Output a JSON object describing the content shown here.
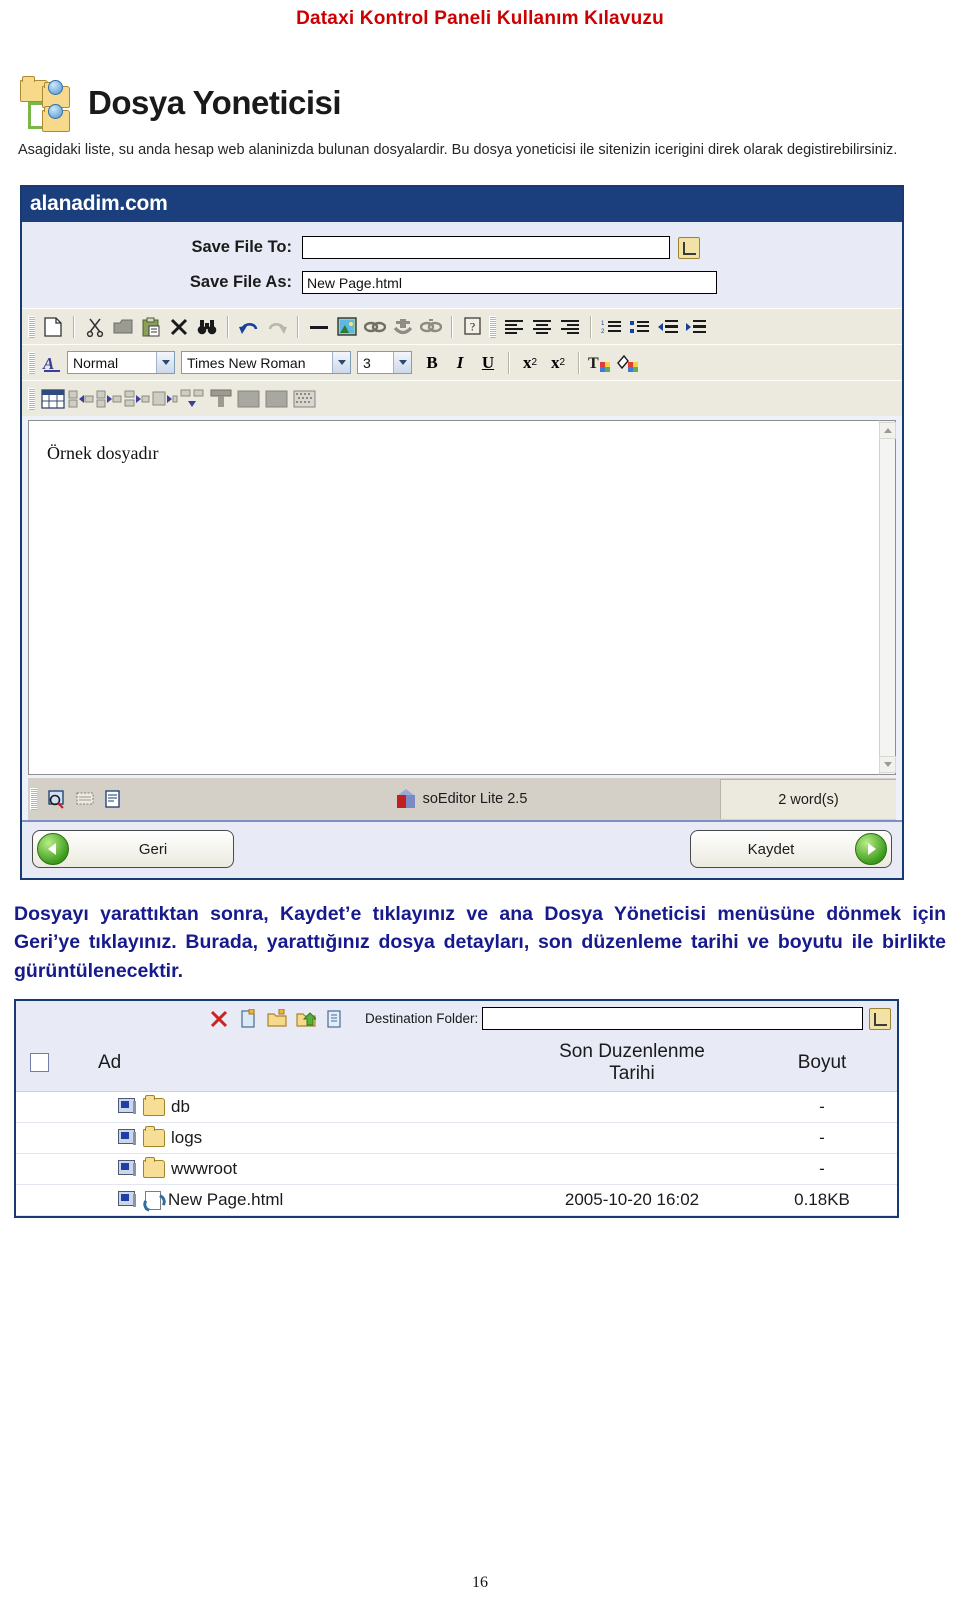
{
  "document": {
    "header_title": "Dataxi Kontrol Paneli Kullanım Kılavuzu",
    "page_number": "16",
    "header_color": "#cc0000"
  },
  "section": {
    "icon": "folders-network-icon",
    "title": "Dosya Yoneticisi",
    "description": "Asagidaki liste, su anda hesap web alaninizda bulunan dosyalardir. Bu dosya yoneticisi ile sitenizin icerigini direk olarak degistirebilirsiniz."
  },
  "editor_window": {
    "titlebar": "alanadim.com",
    "titlebar_color": "#1b3f7d",
    "fields": [
      {
        "label": "Save File To:",
        "value": "",
        "placeholder": "",
        "browse_icon": "browse-folder-icon"
      },
      {
        "label": "Save File As:",
        "value": "New Page.html",
        "placeholder": ""
      }
    ],
    "toolbar_row1": [
      {
        "name": "new-document-icon",
        "title": "New"
      },
      {
        "name": "cut-scissors-icon",
        "title": "Cut"
      },
      {
        "name": "copy-icon",
        "title": "Copy"
      },
      {
        "name": "paste-clipboard-icon",
        "title": "Paste"
      },
      {
        "name": "delete-x-icon",
        "title": "Delete"
      },
      {
        "name": "find-binoculars-icon",
        "title": "Find"
      },
      {
        "name": "undo-arrow-icon",
        "title": "Undo"
      },
      {
        "name": "redo-arrow-icon",
        "title": "Redo"
      },
      {
        "name": "horizontal-rule-icon",
        "title": "Horizontal Rule"
      },
      {
        "name": "insert-image-icon",
        "title": "Insert Image"
      },
      {
        "name": "insert-link-icon",
        "title": "Insert Hyperlink"
      },
      {
        "name": "anchor-icon",
        "title": "Insert Anchor"
      },
      {
        "name": "remove-link-icon",
        "title": "Remove Link"
      },
      {
        "name": "help-question-icon",
        "title": "Help"
      },
      {
        "name": "align-left-icon",
        "title": "Align Left"
      },
      {
        "name": "align-center-icon",
        "title": "Align Center"
      },
      {
        "name": "align-right-icon",
        "title": "Align Right"
      },
      {
        "name": "numbered-list-icon",
        "title": "Ordered List"
      },
      {
        "name": "bulleted-list-icon",
        "title": "Unordered List"
      },
      {
        "name": "decrease-indent-icon",
        "title": "Decrease Indent"
      },
      {
        "name": "increase-indent-icon",
        "title": "Increase Indent"
      }
    ],
    "toolbar_row2": {
      "style_icon": "font-style-icon",
      "style_value": "Normal",
      "font_value": "Times New Roman",
      "size_value": "3",
      "bold_label": "B",
      "italic_label": "I",
      "underline_label": "U",
      "superscript_label": "x",
      "superscript_sup": "2",
      "subscript_label": "x",
      "subscript_sub": "2",
      "text_color_icon": "text-color-icon",
      "highlight_color_icon": "highlight-color-icon"
    },
    "toolbar_row3": [
      {
        "name": "insert-table-icon",
        "title": "Insert Table"
      },
      {
        "name": "insert-row-above-icon",
        "title": "Insert Row Above"
      },
      {
        "name": "insert-row-below-icon",
        "title": "Insert Row Below"
      },
      {
        "name": "insert-column-icon",
        "title": "Insert Column"
      },
      {
        "name": "delete-cell-icon",
        "title": "Delete Cell"
      },
      {
        "name": "merge-cells-icon",
        "title": "Merge Cells"
      },
      {
        "name": "split-cell-icon",
        "title": "Split Cell"
      },
      {
        "name": "cell-properties-icon",
        "title": "Cell Properties"
      },
      {
        "name": "table-properties-icon",
        "title": "Table Properties"
      },
      {
        "name": "table-background-icon",
        "title": "Table Background"
      }
    ],
    "content": "Örnek dosyadır",
    "statusbar": {
      "left_icons": [
        {
          "name": "preview-icon",
          "title": "Preview"
        },
        {
          "name": "design-view-icon",
          "title": "Design"
        },
        {
          "name": "html-source-icon",
          "title": "HTML Source"
        }
      ],
      "product_icon": "soeditor-cube-icon",
      "product_name": "soEditor Lite 2.5",
      "word_count": "2 word(s)"
    },
    "actions": {
      "back_label": "Geri",
      "back_icon": "arrow-left-circle-icon",
      "save_label": "Kaydet",
      "save_icon": "arrow-right-circle-icon"
    }
  },
  "body_paragraph": "Dosyayı yarattıktan sonra, Kaydet’e tıklayınız ve ana Dosya Yöneticisi menüsüne dönmek için Geri’ye tıklayınız. Burada, yarattığınız dosya detayları, son düzenleme tarihi ve boyutu ile birlikte gürüntülenecektir.",
  "file_manager": {
    "toolbar": [
      {
        "name": "delete-red-x-icon",
        "title": "Delete"
      },
      {
        "name": "new-file-icon",
        "title": "New File"
      },
      {
        "name": "new-folder-icon",
        "title": "New Folder"
      },
      {
        "name": "upload-file-icon",
        "title": "Upload"
      },
      {
        "name": "copy-file-icon",
        "title": "Copy"
      }
    ],
    "destination_label": "Destination Folder:",
    "destination_value": "",
    "destination_browse_icon": "browse-folder-icon",
    "columns": [
      "",
      "Ad",
      "Son Duzenlenme Tarihi",
      "Boyut"
    ],
    "column_header_date_line1": "Son Duzenlenme",
    "column_header_date_line2": "Tarihi",
    "rows": [
      {
        "icon": "folder-icon",
        "name": "db",
        "date": "",
        "size": "-"
      },
      {
        "icon": "folder-icon",
        "name": "logs",
        "date": "",
        "size": "-"
      },
      {
        "icon": "folder-icon",
        "name": "wwwroot",
        "date": "",
        "size": "-"
      },
      {
        "icon": "html-file-icon",
        "name": "New Page.html",
        "date": "2005-10-20 16:02",
        "size": "0.18KB"
      }
    ]
  }
}
